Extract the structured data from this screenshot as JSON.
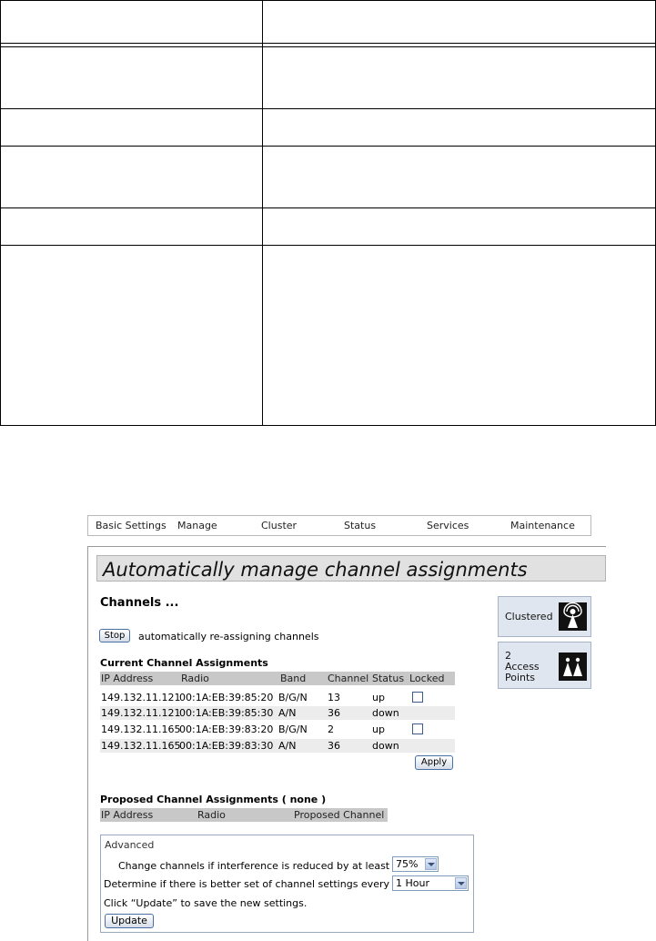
{
  "navigation": {
    "items": [
      "Basic Settings",
      "Manage",
      "Cluster",
      "Status",
      "Services",
      "Maintenance"
    ]
  },
  "page": {
    "title": "Automatically manage channel assignments",
    "heading": "Channels ..."
  },
  "stop_control": {
    "button_label": "Stop",
    "description": "automatically re-assigning channels"
  },
  "current_assignments": {
    "title": "Current Channel Assignments",
    "columns": [
      "IP Address",
      "Radio",
      "Band",
      "Channel",
      "Status",
      "Locked"
    ],
    "rows": [
      {
        "ip": "149.132.11.121",
        "radio": "00:1A:EB:39:85:20",
        "band": "B/G/N",
        "channel": "13",
        "status": "up",
        "lockable": true
      },
      {
        "ip": "149.132.11.121",
        "radio": "00:1A:EB:39:85:30",
        "band": "A/N",
        "channel": "36",
        "status": "down",
        "lockable": false
      },
      {
        "ip": "149.132.11.165",
        "radio": "00:1A:EB:39:83:20",
        "band": "B/G/N",
        "channel": "2",
        "status": "up",
        "lockable": true
      },
      {
        "ip": "149.132.11.165",
        "radio": "00:1A:EB:39:83:30",
        "band": "A/N",
        "channel": "36",
        "status": "down",
        "lockable": false
      }
    ],
    "apply_label": "Apply"
  },
  "proposed_assignments": {
    "title": "Proposed Channel Assignments ( none )",
    "columns": [
      "IP Address",
      "Radio",
      "Proposed Channel"
    ]
  },
  "sidebar": {
    "cluster_label": "Clustered",
    "ap_count": "2",
    "ap_label_line1": "Access",
    "ap_label_line2": "Points"
  },
  "advanced": {
    "label": "Advanced",
    "interference_label": "Change channels if interference is reduced by at least",
    "interference_value": "75%",
    "interval_label": "Determine if there is better set of channel settings every",
    "interval_value": "1 Hour",
    "update_hint": "Click “Update” to save the new settings.",
    "update_label": "Update"
  },
  "colors": {
    "title_bar": "#e1e1e1",
    "header_row": "#c8c8c8",
    "shaded_row": "#ececec",
    "side_box": "#dfe6ef"
  }
}
